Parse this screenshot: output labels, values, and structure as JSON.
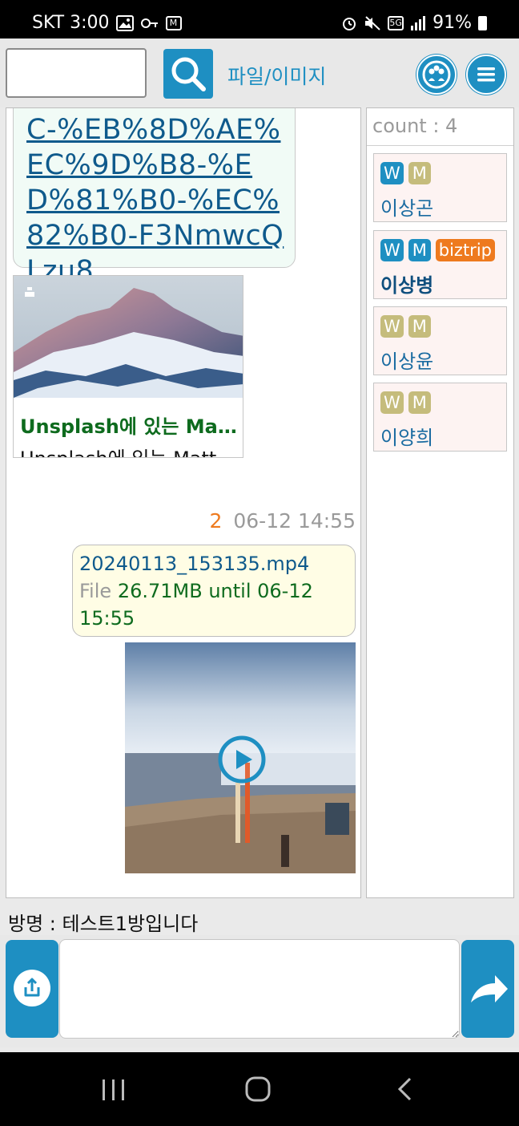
{
  "status_bar": {
    "carrier_time": "SKT 3:00",
    "left_icons": [
      "image-icon",
      "vpn-key-icon",
      "mstock-icon"
    ],
    "mstock_label": "M",
    "right_icons": [
      "alarm-icon",
      "mute-icon",
      "5g-icon",
      "signal-icon"
    ],
    "five_g_label": "5G",
    "battery": "91%"
  },
  "header": {
    "search_placeholder": "",
    "file_image_label": "파일/이미지"
  },
  "chat": {
    "link_url": "C-%EB%8D%AE%EC%9D%B8-%ED%81%B0-%EC%82%B0-F3NmwcQLzu8",
    "preview": {
      "title": "Unsplash에 있는 Matt Hardy의 사진",
      "description": "Unsplash에 있는 Matt Hardy의 사진"
    },
    "file_message": {
      "unread_count": "2",
      "time": "06-12 14:55",
      "filename": "20240113_153135.mp4",
      "kind_label": "File",
      "info": "26.71MB until 06-12 15:55"
    }
  },
  "members": {
    "count_label": "count : 4",
    "list": [
      {
        "name": "이상곤",
        "w": "W",
        "m": "M",
        "w_active": true,
        "m_active": false,
        "extra": "",
        "bold": false
      },
      {
        "name": "이상병",
        "w": "W",
        "m": "M",
        "w_active": true,
        "m_active": true,
        "extra": "biztrip",
        "bold": true
      },
      {
        "name": "이상윤",
        "w": "W",
        "m": "M",
        "w_active": false,
        "m_active": false,
        "extra": "",
        "bold": false
      },
      {
        "name": "이양희",
        "w": "W",
        "m": "M",
        "w_active": false,
        "m_active": false,
        "extra": "",
        "bold": false
      }
    ]
  },
  "footer": {
    "room_name": "방명 : 테스트1방입니다",
    "message_placeholder": ""
  },
  "colors": {
    "accent": "#1e8fc2",
    "orange": "#ee7a1e",
    "link_blue": "#0f5a8c",
    "green_text": "#0e6b1e",
    "badge_inactive": "#c5bc7c"
  }
}
